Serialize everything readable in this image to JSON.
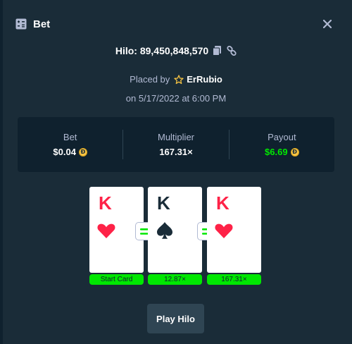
{
  "modal": {
    "title": "Bet",
    "close_icon": "close-icon",
    "header_icon": "bet-slip-icon"
  },
  "bet": {
    "game_and_id": "Hilo: 89,450,848,570",
    "copy_icon": "copy-icon",
    "link_icon": "link-icon",
    "placed_by_label": "Placed by",
    "user": "ErRubio",
    "user_badge_icon": "star-outline-icon",
    "date": "on 5/17/2022 at 6:00 PM"
  },
  "stats": {
    "bet_label": "Bet",
    "bet_value": "$0.04",
    "multiplier_label": "Multiplier",
    "multiplier_value": "167.31×",
    "payout_label": "Payout",
    "payout_value": "$6.69",
    "currency_icon": "dogecoin-icon",
    "currency_symbol": "Ð"
  },
  "cards": [
    {
      "rank": "K",
      "suit": "hearts",
      "color": "#fe2247",
      "label": "Start Card"
    },
    {
      "rank": "K",
      "suit": "spades",
      "color": "#1a2c38",
      "label": "12.87×"
    },
    {
      "rank": "K",
      "suit": "hearts",
      "color": "#fe2247",
      "label": "167.31×"
    }
  ],
  "guesses": [
    {
      "icon": "equal-icon"
    },
    {
      "icon": "equal-icon"
    }
  ],
  "actions": {
    "play_button": "Play Hilo"
  },
  "colors": {
    "background": "#1a2c38",
    "panel": "#0f212e",
    "accent_green": "#00e701",
    "red_suit": "#fe2247",
    "muted_text": "#b1bad3",
    "button": "#2f4553",
    "coin": "#f6c343"
  }
}
